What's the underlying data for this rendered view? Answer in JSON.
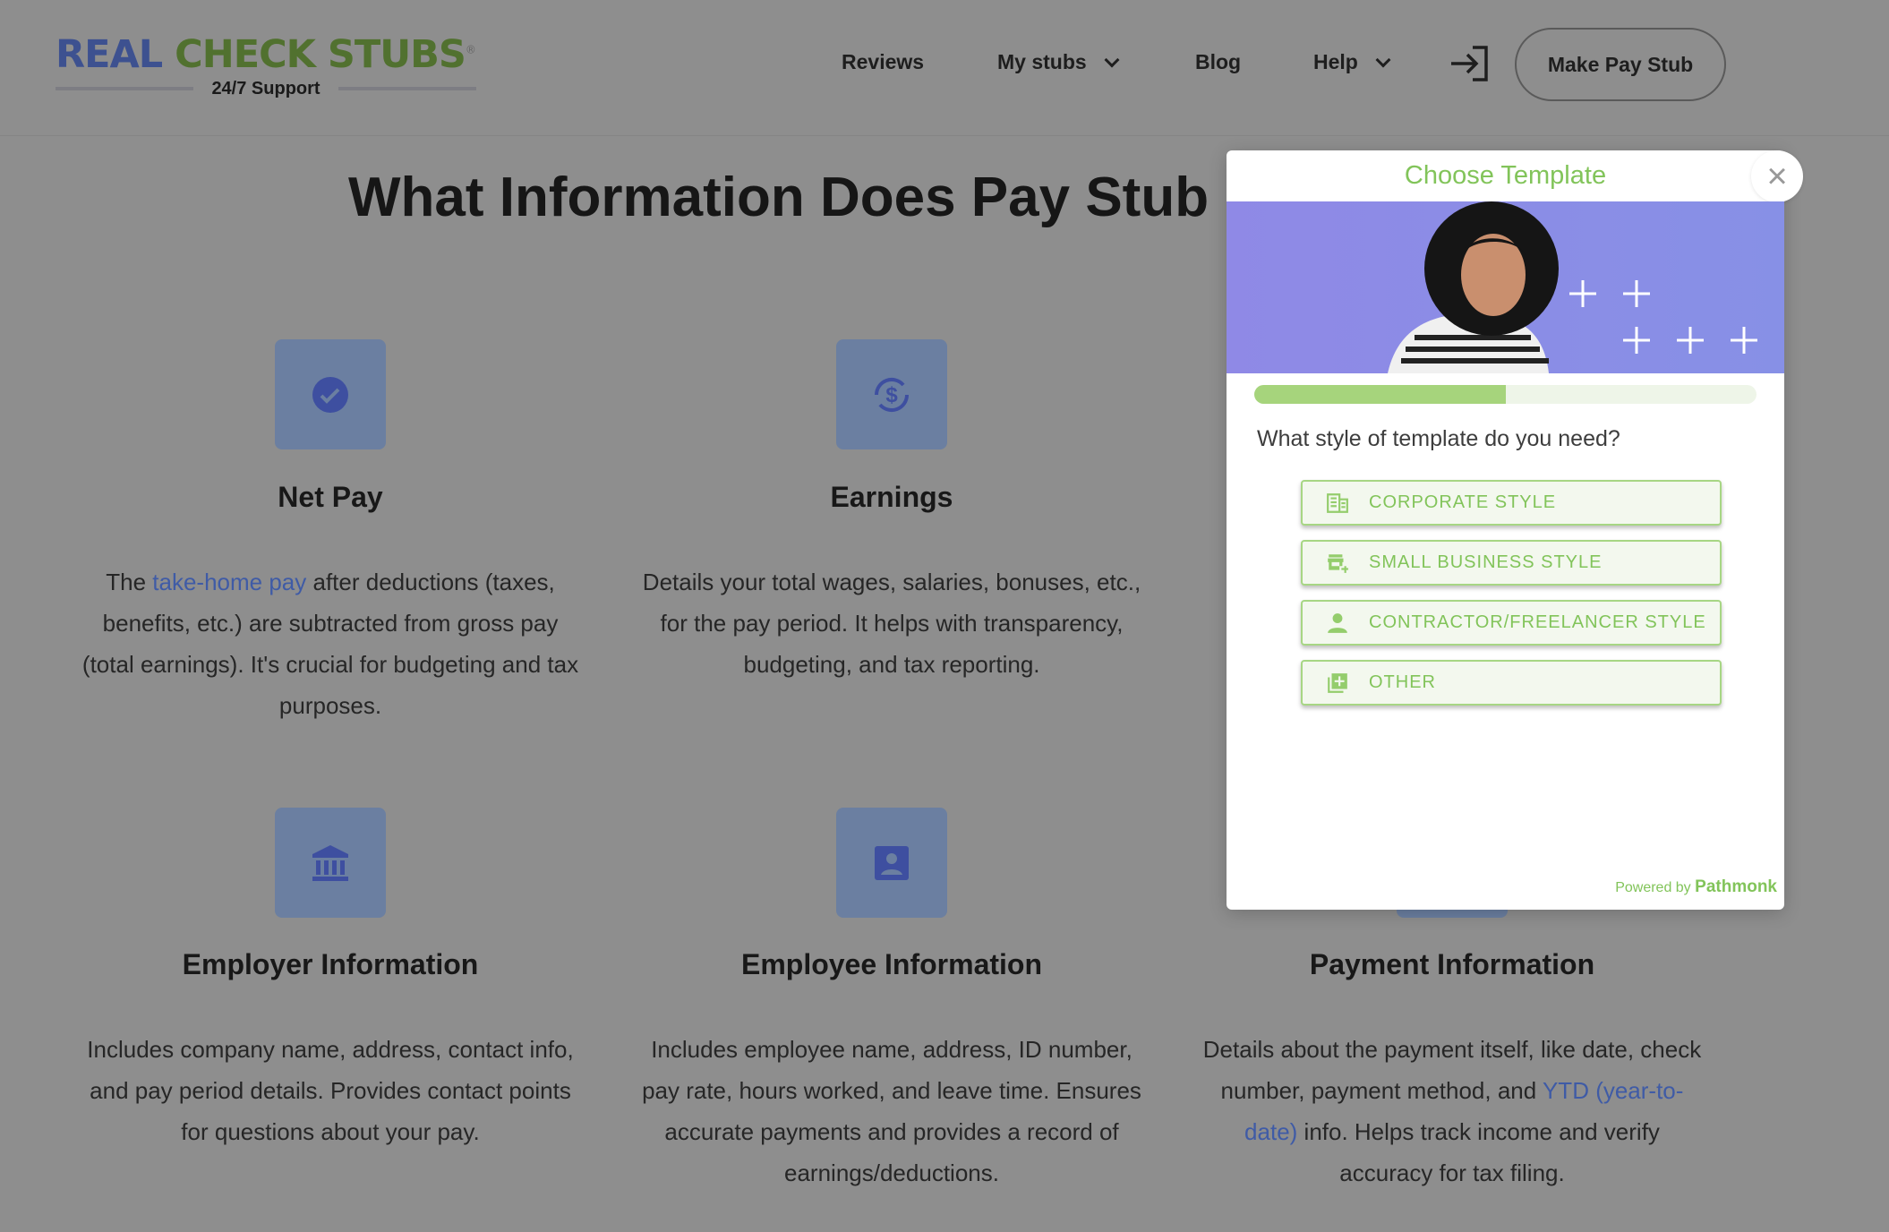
{
  "header": {
    "logo_part1": "REAL",
    "logo_part2": "CHECK STUBS",
    "logo_mark": "®",
    "support": "24/7 Support",
    "nav": [
      {
        "label": "Reviews"
      },
      {
        "label": "My stubs"
      },
      {
        "label": "Blog"
      },
      {
        "label": "Help"
      }
    ],
    "login_icon": "login-icon",
    "cta": "Make Pay Stub"
  },
  "main": {
    "title": "What Information Does Pay Stub I",
    "cards": [
      {
        "heading": "Net Pay",
        "text_before": "The ",
        "link": "take-home pay",
        "text_after": " after deductions (taxes, benefits, etc.) are subtracted from gross pay (total earnings). It's crucial for budgeting and tax purposes.",
        "icon": "discount-check-icon"
      },
      {
        "heading": "Earnings",
        "text": "Details your total wages, salaries, bonuses, etc., for the pay period. It helps with transparency, budgeting, and tax reporting.",
        "icon": "dollar-refresh-icon"
      },
      {
        "heading": "Employer Information",
        "text": "Includes company name, address, contact info, and pay period details. Provides contact points for questions about your pay.",
        "icon": "bank-icon"
      },
      {
        "heading": "Employee Information",
        "text": "Includes employee name, address, ID number, pay rate, hours worked, and leave time. Ensures accurate payments and provides a record of earnings/deductions.",
        "icon": "person-badge-icon"
      },
      {
        "heading": "Payment Information",
        "text_before": "Details about the payment itself, like date, check number, payment method, and ",
        "link": "YTD (year-to-date)",
        "text_after": " info. Helps track income and verify accuracy for tax filing."
      }
    ]
  },
  "modal": {
    "title": "Choose Template",
    "progress_percent": 50,
    "question": "What style of template do you need?",
    "options": [
      {
        "label": "CORPORATE STYLE",
        "icon": "building-icon"
      },
      {
        "label": "SMALL BUSINESS STYLE",
        "icon": "store-plus-icon"
      },
      {
        "label": "CONTRACTOR/FREELANCER STYLE",
        "icon": "person-icon"
      },
      {
        "label": "OTHER",
        "icon": "library-add-icon"
      }
    ],
    "powered_prefix": "Powered by",
    "powered_brand": "Pathmonk"
  },
  "colors": {
    "accent_green": "#82c45a",
    "brand_blue": "#3d5190",
    "brand_green": "#51712f",
    "hero_purple": "#8f89e6"
  }
}
